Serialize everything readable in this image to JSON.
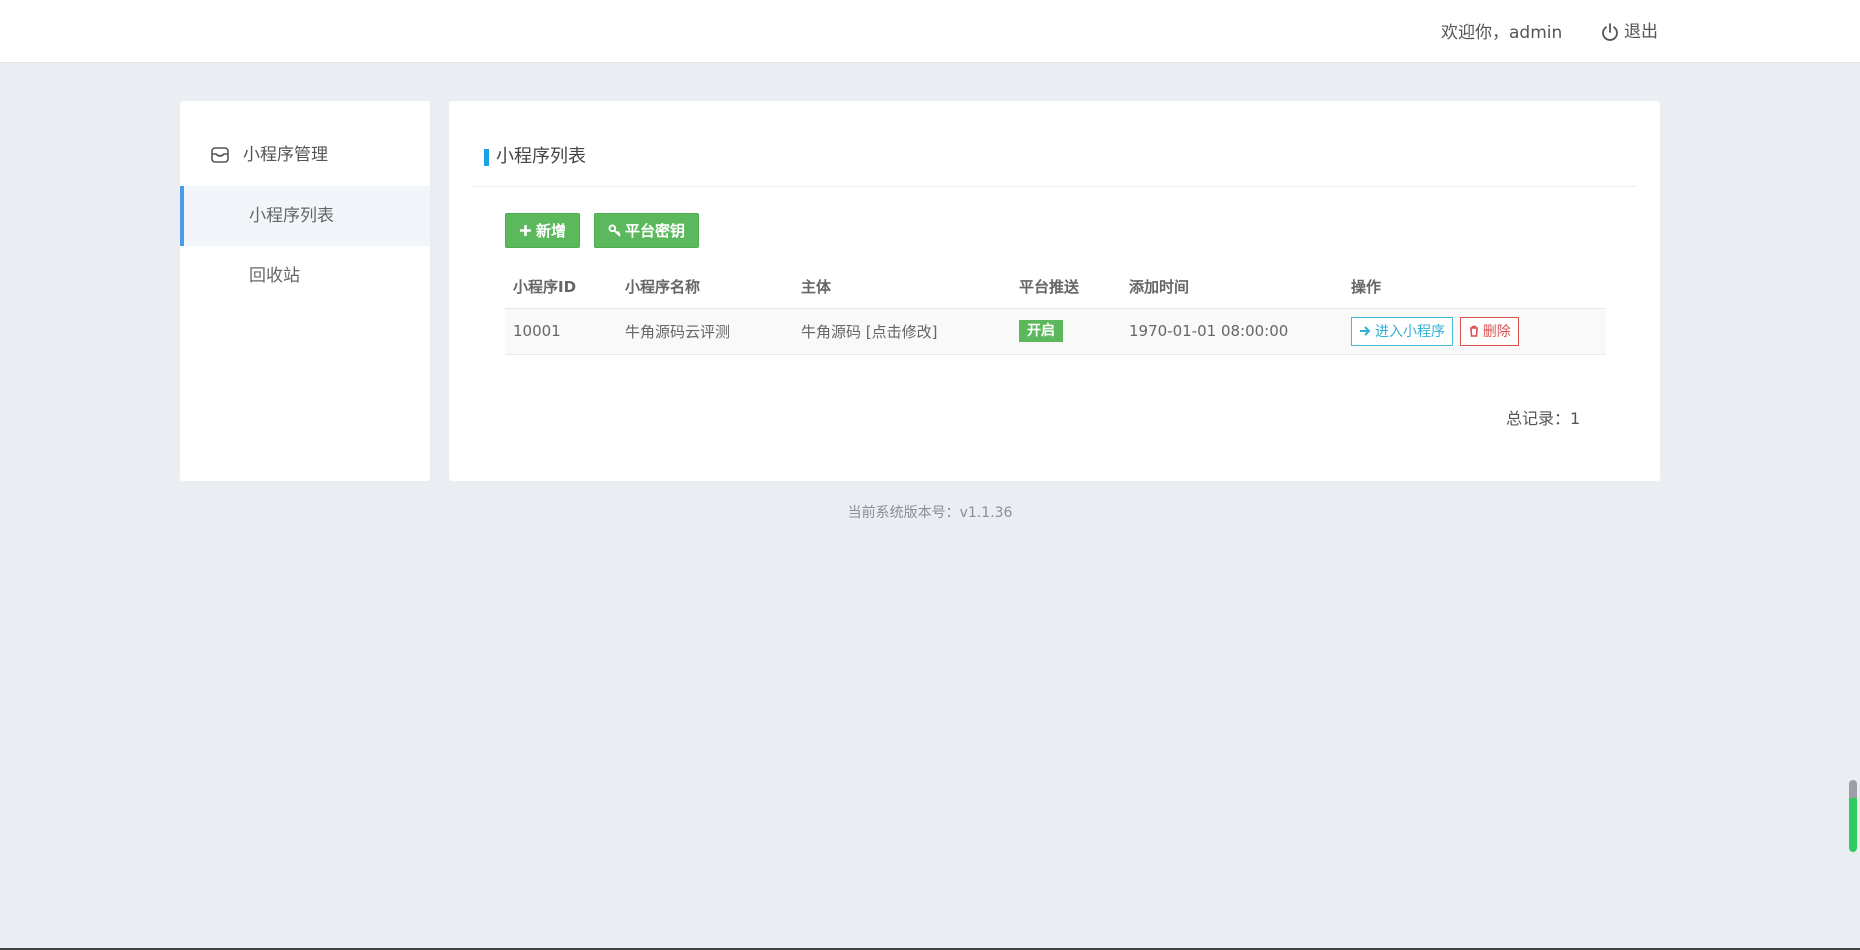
{
  "header": {
    "welcome": "欢迎你，admin",
    "logout_label": "退出"
  },
  "sidebar": {
    "group_label": "小程序管理",
    "group_icon": "store-icon",
    "items": [
      {
        "label": "小程序列表",
        "active": true
      },
      {
        "label": "回收站",
        "active": false
      }
    ]
  },
  "main": {
    "title": "小程序列表",
    "add_button": "新增",
    "key_button": "平台密钥",
    "columns": [
      "小程序ID",
      "小程序名称",
      "主体",
      "平台推送",
      "添加时间",
      "操作"
    ],
    "rows": [
      {
        "id": "10001",
        "name": "牛角源码云评测",
        "subject": "牛角源码 [点击修改]",
        "push": "开启",
        "time": "1970-01-01 08:00:00",
        "enter_label": "进入小程序",
        "delete_label": "删除"
      }
    ],
    "total": "总记录：1"
  },
  "footer": {
    "version": "当前系统版本号：v1.1.36"
  },
  "colors": {
    "accent": "#19a1ea",
    "success": "#5cb85c",
    "info": "#31b0d5",
    "danger": "#d9534f",
    "background": "#eaedf1"
  }
}
